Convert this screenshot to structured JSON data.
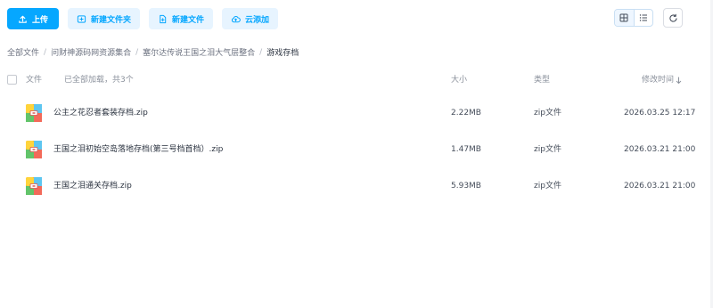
{
  "toolbar": {
    "upload": "上传",
    "new_folder": "新建文件夹",
    "new_file": "新建文件",
    "cloud_add": "云添加"
  },
  "colors": {
    "accent": "#06a7ff",
    "accent_soft": "#e7f4ff"
  },
  "breadcrumb": [
    "全部文件",
    "问财神源码网资源集合",
    "塞尔达传说王国之泪大气层整合",
    "游戏存档"
  ],
  "table": {
    "headers": {
      "name": "文件",
      "status": "已全部加载，共3个",
      "size": "大小",
      "type": "类型",
      "modified": "修改时间"
    },
    "sort_icon": "sort-desc-icon",
    "rows": [
      {
        "name": "公主之花忍者套装存档.zip",
        "size": "2.22MB",
        "type": "zip文件",
        "modified": "2026.03.25 12:17",
        "icon": "zip-archive-icon"
      },
      {
        "name": "王国之泪初始空岛落地存档(第三号档首档）.zip",
        "size": "1.47MB",
        "type": "zip文件",
        "modified": "2026.03.21 21:00",
        "icon": "zip-archive-icon"
      },
      {
        "name": "王国之泪通关存档.zip",
        "size": "5.93MB",
        "type": "zip文件",
        "modified": "2026.03.21 21:00",
        "icon": "zip-archive-icon"
      }
    ]
  }
}
